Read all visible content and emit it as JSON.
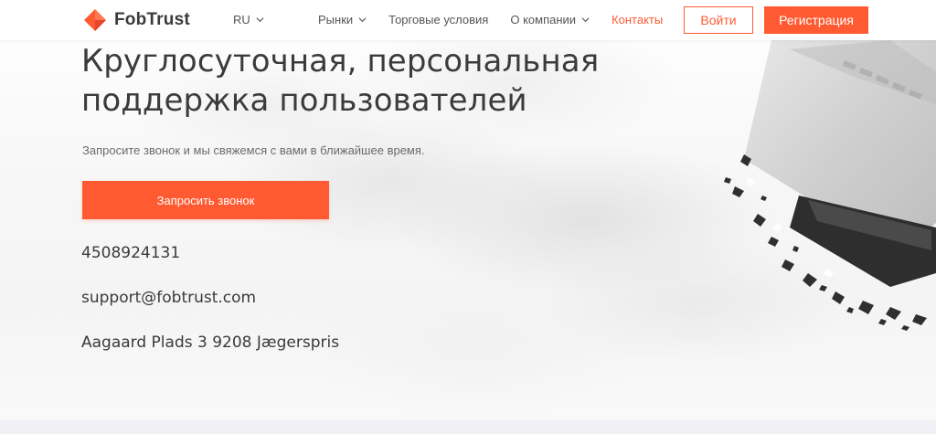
{
  "header": {
    "logo_text": "FobTrust",
    "language": "RU",
    "nav": [
      {
        "label": "Рынки",
        "has_dropdown": true
      },
      {
        "label": "Торговые условия",
        "has_dropdown": false
      },
      {
        "label": "О компании",
        "has_dropdown": true
      },
      {
        "label": "Контакты",
        "has_dropdown": false,
        "active": true
      }
    ],
    "login_label": "Войти",
    "register_label": "Регистрация"
  },
  "hero": {
    "title_line1": "Круглосуточная, персональная",
    "title_line2": "поддержка пользователей",
    "subtitle": "Запросите звонок и мы свяжемся с вами в ближайшее время.",
    "callback_label": "Запросить звонок",
    "phone": "4508924131",
    "email": "support@fobtrust.com",
    "address": "Aagaard Plads 3 9208 Jægerspris"
  },
  "colors": {
    "accent": "#ff5a32",
    "text_dark": "#3b3b3b",
    "text_muted": "#6b6b6b"
  },
  "icons": {
    "logo": "orange-diamond-logo",
    "dropdown": "chevron-down-icon"
  }
}
